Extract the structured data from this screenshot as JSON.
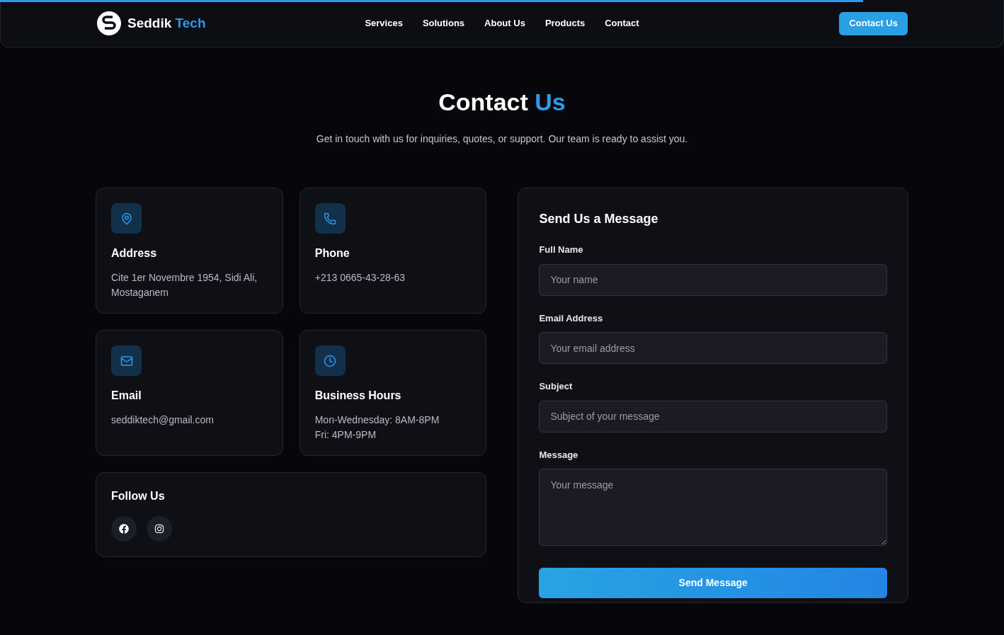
{
  "progress": {
    "level": 0.86
  },
  "header": {
    "brand": {
      "first": "Seddik",
      "second": "Tech"
    },
    "nav": [
      {
        "label": "Services"
      },
      {
        "label": "Solutions"
      },
      {
        "label": "About Us"
      },
      {
        "label": "Products"
      },
      {
        "label": "Contact"
      }
    ],
    "cta": "Contact Us"
  },
  "hero": {
    "title_first": "Contact",
    "title_second": "Us",
    "subtitle": "Get in touch with us for inquiries, quotes, or support. Our team is ready to assist you."
  },
  "info_cards": [
    {
      "kind": "address",
      "title": "Address",
      "lines": [
        "Cite 1er Novembre 1954, Sidi Ali,",
        "Mostaganem"
      ]
    },
    {
      "kind": "phone",
      "title": "Phone",
      "lines": [
        "+213 0665-43-28-63"
      ]
    },
    {
      "kind": "email",
      "title": "Email",
      "lines": [
        "seddiktech@gmail.com"
      ]
    },
    {
      "kind": "hours",
      "title": "Business Hours",
      "lines": [
        "Mon-Wednesday: 8AM-8PM",
        "Fri: 4PM-9PM"
      ]
    }
  ],
  "follow": {
    "title": "Follow Us",
    "links": [
      {
        "kind": "facebook"
      },
      {
        "kind": "instagram"
      }
    ]
  },
  "form": {
    "title": "Send Us a Message",
    "fields": [
      {
        "kind": "input",
        "label": "Full Name",
        "placeholder": "Your name"
      },
      {
        "kind": "input",
        "label": "Email Address",
        "placeholder": "Your email address"
      },
      {
        "kind": "input",
        "label": "Subject",
        "placeholder": "Subject of your message"
      },
      {
        "kind": "textarea",
        "label": "Message",
        "placeholder": "Your message"
      }
    ],
    "submit": "Send Message"
  }
}
